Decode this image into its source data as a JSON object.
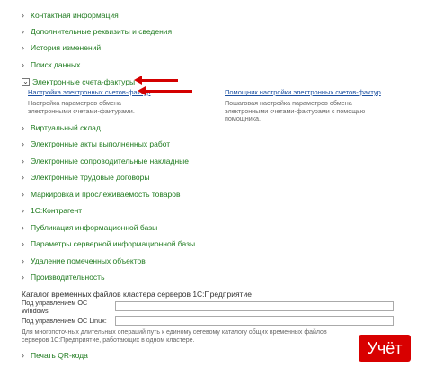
{
  "menu": {
    "items": [
      {
        "label": "Контактная информация"
      },
      {
        "label": "Дополнительные реквизиты и сведения"
      },
      {
        "label": "История изменений"
      },
      {
        "label": "Поиск данных"
      },
      {
        "label": "Электронные счета-фактуры"
      },
      {
        "label": "Виртуальный склад"
      },
      {
        "label": "Электронные акты выполненных работ"
      },
      {
        "label": "Электронные сопроводительные накладные"
      },
      {
        "label": "Электронные трудовые договоры"
      },
      {
        "label": "Маркировка и прослеживаемость товаров"
      },
      {
        "label": "1С:Контрагент"
      },
      {
        "label": "Публикация информационной базы"
      },
      {
        "label": "Параметры серверной информационной базы"
      },
      {
        "label": "Удаление помеченных объектов"
      },
      {
        "label": "Производительность"
      },
      {
        "label": "Печать QR-кода"
      }
    ]
  },
  "einvoice": {
    "link1": "Настройка электронных счетов-фактур",
    "desc1": "Настройка параметров обмена электронными счетами-фактурами.",
    "link2": "Помощник настройки электронных счетов-фактур",
    "desc2": "Пошаговая настройка параметров обмена электронными счетами-фактурами с помощью помощника."
  },
  "cluster": {
    "title": "Каталог временных файлов кластера серверов 1С:Предприятие",
    "windows_label": "Под управлением ОС Windows:",
    "windows_value": "",
    "linux_label": "Под управлением ОС Linux:",
    "linux_value": "",
    "hint": "Для многопоточных длительных операций путь к единому сетевому каталогу общих временных файлов серверов 1С:Предприятие, работающих в одном кластере."
  },
  "watermark": {
    "text": "Учёт"
  },
  "colors": {
    "link_green": "#1e7a1e",
    "link_blue": "#1a4fa0",
    "arrow_red": "#d40000",
    "badge_red": "#d80000"
  }
}
